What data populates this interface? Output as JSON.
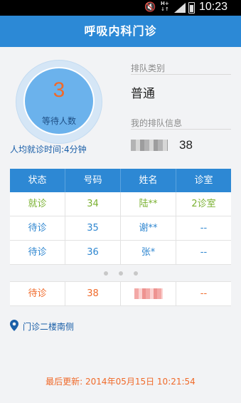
{
  "status_bar": {
    "time": "10:23",
    "network_top": "H+",
    "network_bottom": "↓↑"
  },
  "title": "呼吸内科门诊",
  "waiting": {
    "count": "3",
    "label": "等待人数",
    "avg_time": "人均就诊时间:4分钟"
  },
  "queue_type": {
    "label": "排队类别",
    "value": "普通"
  },
  "my_queue": {
    "label": "我的排队信息",
    "number": "38"
  },
  "table": {
    "headers": [
      "状态",
      "号码",
      "姓名",
      "诊室"
    ],
    "rows": [
      {
        "status": "就诊",
        "number": "34",
        "name": "陆**",
        "room": "2诊室"
      },
      {
        "status": "待诊",
        "number": "35",
        "name": "谢**",
        "room": "--"
      },
      {
        "status": "待诊",
        "number": "36",
        "name": "张*",
        "room": "--"
      }
    ],
    "my_row": {
      "status": "待诊",
      "number": "38",
      "room": "--"
    }
  },
  "location": "门诊二楼南侧",
  "last_updated": "最后更新: 2014年05月15日 10:21:54",
  "colors": {
    "accent": "#2c89d6",
    "in_progress": "#7ab131",
    "waiting": "#2e86d0",
    "mine": "#f06a2a"
  },
  "icons": {
    "mute": "mute-icon",
    "signal": "signal-icon",
    "battery": "battery-icon",
    "location": "location-pin-icon"
  }
}
